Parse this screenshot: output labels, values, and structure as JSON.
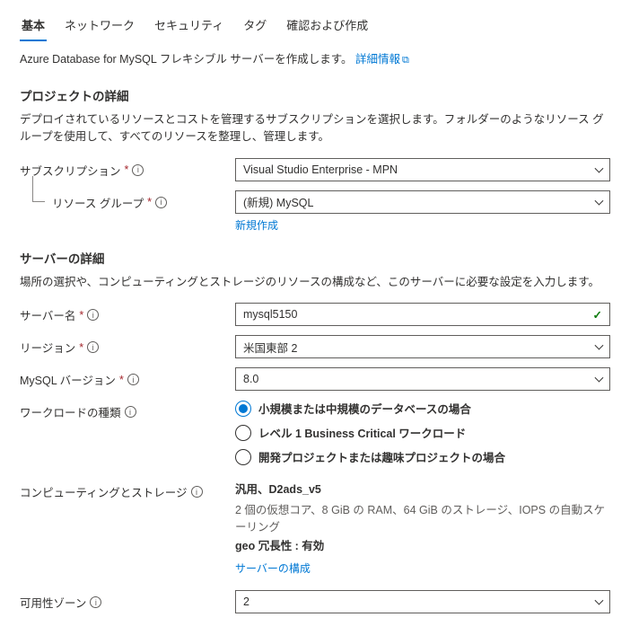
{
  "tabs": {
    "basic": "基本",
    "network": "ネットワーク",
    "security": "セキュリティ",
    "tags": "タグ",
    "review": "確認および作成"
  },
  "intro": {
    "text": "Azure Database for MySQL フレキシブル サーバーを作成します。",
    "link": "詳細情報"
  },
  "project": {
    "heading": "プロジェクトの詳細",
    "desc": "デプロイされているリソースとコストを管理するサブスクリプションを選択します。フォルダーのようなリソース グループを使用して、すべてのリソースを整理し、管理します。",
    "subscription_label": "サブスクリプション",
    "subscription_value": "Visual Studio Enterprise - MPN",
    "resource_group_label": "リソース グループ",
    "resource_group_value": "(新規) MySQL",
    "create_new": "新規作成"
  },
  "server": {
    "heading": "サーバーの詳細",
    "desc": "場所の選択や、コンピューティングとストレージのリソースの構成など、このサーバーに必要な設定を入力します。",
    "name_label": "サーバー名",
    "name_value": "mysql5150",
    "region_label": "リージョン",
    "region_value": "米国東部 2",
    "version_label": "MySQL バージョン",
    "version_value": "8.0",
    "workload_label": "ワークロードの種類",
    "workload_options": {
      "opt1": "小規模または中規模のデータベースの場合",
      "opt2": "レベル 1 Business Critical ワークロード",
      "opt3": "開発プロジェクトまたは趣味プロジェクトの場合"
    },
    "compute_label": "コンピューティングとストレージ",
    "compute": {
      "title": "汎用、D2ads_v5",
      "spec": "2 個の仮想コア、8 GiB の RAM、64 GiB のストレージ、IOPS の自動スケーリング",
      "geo": "geo 冗長性 : 有効",
      "config_link": "サーバーの構成"
    },
    "az_label": "可用性ゾーン",
    "az_value": "2"
  }
}
